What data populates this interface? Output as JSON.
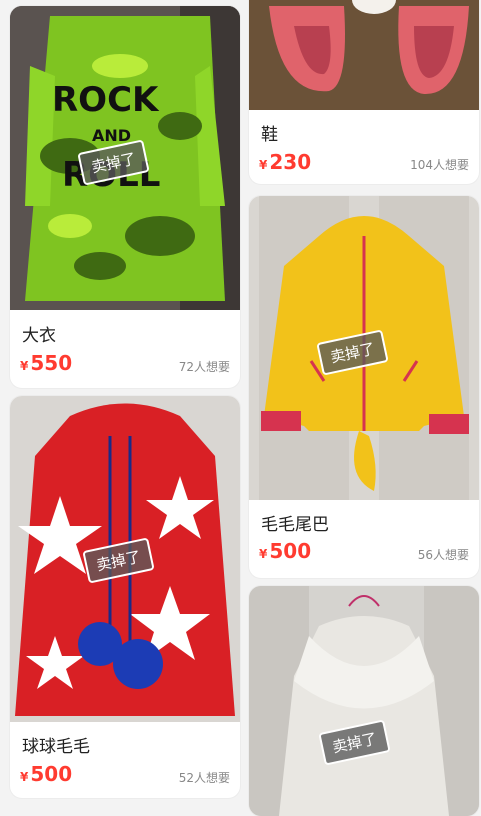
{
  "sold_stamp": "卖掉了",
  "items": [
    {
      "title": "大衣",
      "currency": "¥",
      "price": "550",
      "want": "72人想要"
    },
    {
      "title": "鞋",
      "currency": "¥",
      "price": "230",
      "want": "104人想要"
    },
    {
      "title": "毛毛尾巴",
      "currency": "¥",
      "price": "500",
      "want": "56人想要"
    },
    {
      "title": "球球毛毛",
      "currency": "¥",
      "price": "500",
      "want": "52人想要"
    },
    {
      "title": "",
      "currency": "",
      "price": "",
      "want": ""
    }
  ],
  "photo_text": {
    "rock": "ROCK",
    "and": "AND",
    "roll": "ROLL"
  }
}
